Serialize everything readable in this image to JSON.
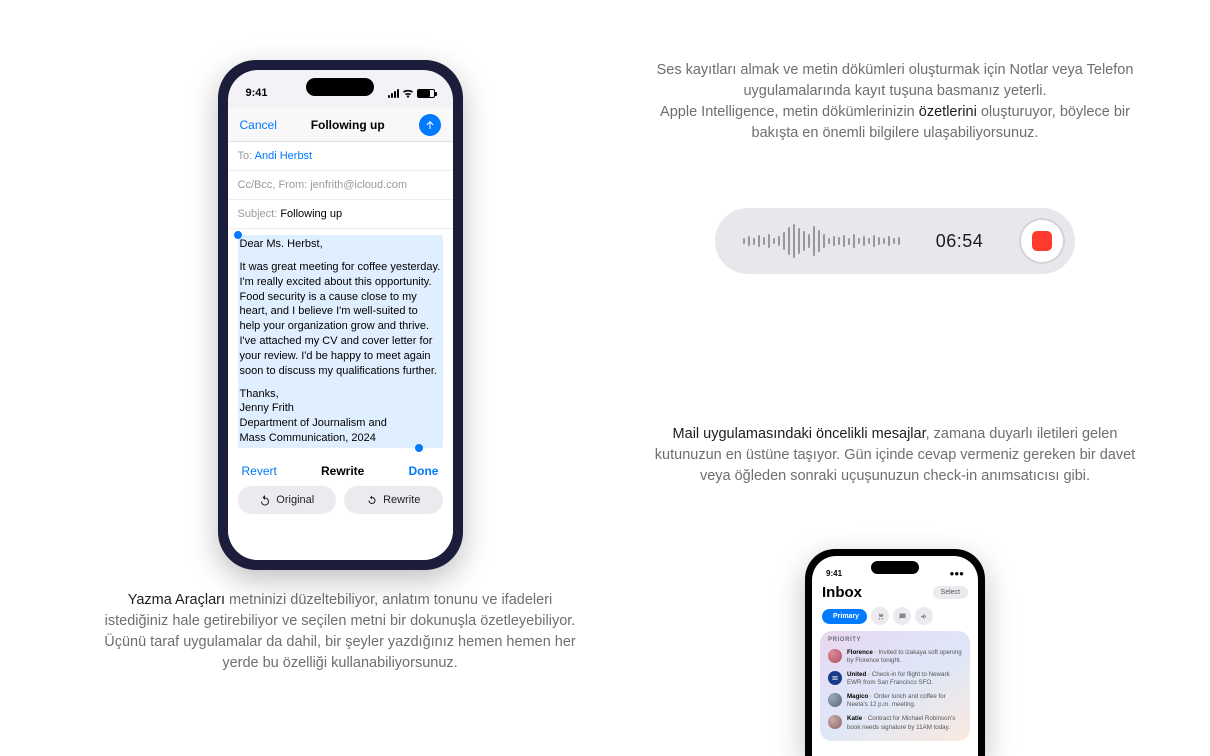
{
  "left_caption": {
    "highlight": "Yazma Araçları",
    "rest": " metninizi düzeltebiliyor, anlatım tonunu ve ifadeleri istediğiniz hale getirebiliyor ve seçilen metni bir dokunuşla özetleyebiliyor. Üçünü taraf uygulamalar da dahil, bir şeyler yazdığınız hemen hemen her yerde bu özelliği kullanabiliyorsunuz."
  },
  "right_caption_1": {
    "line1": "Ses kayıtları almak ve metin dökümleri oluşturmak için Notlar veya Telefon uygulamalarında kayıt tuşuna basmanız yeterli.",
    "line2a": "Apple Intelligence, metin dökümlerinizin ",
    "line2b_hl": "özetlerini",
    "line2c": " oluşturuyor, böylece bir bakışta en önemli bilgilere ulaşabiliyorsunuz."
  },
  "right_caption_2": {
    "hl": "Mail uygulamasındaki öncelikli mesajlar",
    "rest": ", zamana duyarlı iletileri gelen kutunuzun en üstüne taşıyor. Gün içinde cevap vermeniz gereken bir davet veya öğleden sonraki uçuşunuzun check-in anımsatıcısı gibi."
  },
  "phone1": {
    "time": "9:41",
    "cancel": "Cancel",
    "title": "Following up",
    "to_label": "To:",
    "to_name": "Andi Herbst",
    "cc_label": "Cc/Bcc, From:",
    "cc_val": "jenfrith@icloud.com",
    "subject_label": "Subject:",
    "subject_val": "Following up",
    "body_greeting": "Dear Ms. Herbst,",
    "body_main": "It was great meeting for coffee yesterday. I'm really excited about this opportunity. Food security is a cause close to my heart, and I believe I'm well-suited to help your organization grow and thrive. I've attached my CV and cover letter for your review. I'd be happy to meet again soon to discuss my qualifications further.",
    "body_sig1": "Thanks,",
    "body_sig2": "Jenny Frith",
    "body_sig3": "Department of Journalism and",
    "body_sig4": "Mass Communication, 2024",
    "revert": "Revert",
    "rewrite": "Rewrite",
    "done": "Done",
    "pill_original": "Original",
    "pill_rewrite": "Rewrite"
  },
  "audio": {
    "time": "06:54"
  },
  "phone2": {
    "time": "9:41",
    "select": "Select",
    "title": "Inbox",
    "tab_primary": "Primary",
    "priority_label": "PRIORITY",
    "msgs": [
      {
        "name": "Florence",
        "text": " Invited to izakaya soft opening by Florence tonight."
      },
      {
        "name": "United",
        "text": " Check-in for flight to Newark EWR from San Francisco SFO."
      },
      {
        "name": "Magico",
        "text": " Order lunch and coffee for Neeta's 12 p.m. meeting."
      },
      {
        "name": "Katie",
        "text": " Contract for Michael Robinson's book needs signature by 11AM today."
      }
    ]
  },
  "chart_data": {
    "type": "bar",
    "title": "Audio waveform",
    "categories": [],
    "values": [
      6,
      10,
      7,
      12,
      8,
      14,
      6,
      10,
      18,
      28,
      34,
      26,
      20,
      14,
      30,
      22,
      14,
      6,
      10,
      8,
      12,
      7,
      14,
      6,
      10,
      6,
      12,
      8,
      6,
      10,
      6,
      8
    ]
  }
}
